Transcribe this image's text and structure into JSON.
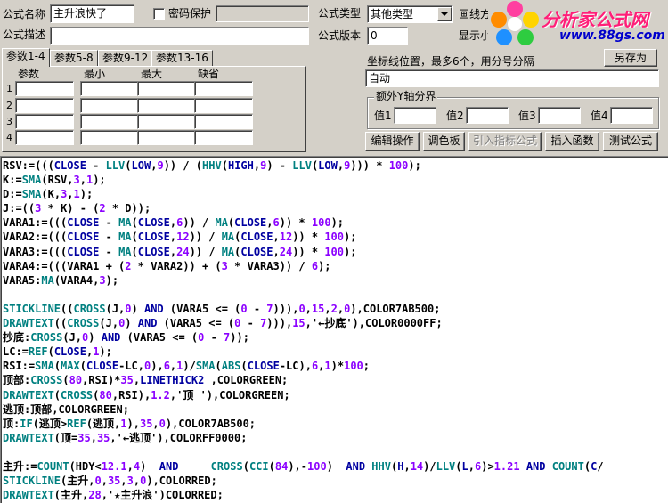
{
  "formula": {
    "name_label": "公式名称",
    "name_value": "主升浪快了",
    "password_label": "密码保护",
    "desc_label": "公式描述",
    "desc_value": "",
    "type_label": "公式类型",
    "type_value": "其他类型",
    "draw_label": "画线方",
    "version_label": "公式版本",
    "version_value": "0",
    "show_label": "显示小"
  },
  "tabs": [
    "参数1-4",
    "参数5-8",
    "参数9-12",
    "参数13-16"
  ],
  "params": {
    "headers": [
      "参数",
      "最小",
      "最大",
      "缺省"
    ],
    "rows": [
      "1",
      "2",
      "3",
      "4"
    ]
  },
  "coord": {
    "label": "坐标线位置，最多6个，用分号分隔",
    "value": "自动",
    "save_as": "另存为"
  },
  "yaxis": {
    "title": "额外Y轴分界",
    "labels": [
      "值1",
      "值2",
      "值3",
      "值4"
    ]
  },
  "buttons": [
    "编辑操作",
    "调色板",
    "引入指标公式",
    "插入函数",
    "测试公式"
  ],
  "logo": {
    "title": "分析家公式网",
    "url": "www.88gs.com"
  },
  "code_lines": [
    "RSV:=(((CLOSE - LLV(LOW,9)) / (HHV(HIGH,9) - LLV(LOW,9))) * 100);",
    "K:=SMA(RSV,3,1);",
    "D:=SMA(K,3,1);",
    "J:=((3 * K) - (2 * D));",
    "VARA1:=(((CLOSE - MA(CLOSE,6)) / MA(CLOSE,6)) * 100);",
    "VARA2:=(((CLOSE - MA(CLOSE,12)) / MA(CLOSE,12)) * 100);",
    "VARA3:=(((CLOSE - MA(CLOSE,24)) / MA(CLOSE,24)) * 100);",
    "VARA4:=(((VARA1 + (2 * VARA2)) + (3 * VARA3)) / 6);",
    "VARA5:MA(VARA4,3);",
    "",
    "STICKLINE((CROSS(J,0) AND (VARA5 <= (0 - 7))),0,15,2,0),COLOR7AB500;",
    "DRAWTEXT((CROSS(J,0) AND (VARA5 <= (0 - 7))),15,'←抄底'),COLOR0000FF;",
    "抄底:CROSS(J,0) AND (VARA5 <= (0 - 7));",
    "LC:=REF(CLOSE,1);",
    "RSI:=SMA(MAX(CLOSE-LC,0),6,1)/SMA(ABS(CLOSE-LC),6,1)*100;",
    "顶部:CROSS(80,RSI)*35,LINETHICK2 ,COLORGREEN;",
    "DRAWTEXT(CROSS(80,RSI),1.2,'顶 '),COLORGREEN;",
    "逃顶:顶部,COLORGREEN;",
    "顶:IF(逃顶>REF(逃顶,1),35,0),COLOR7AB500;",
    "DRAWTEXT(顶=35,35,'←逃顶'),COLORFF0000;",
    "",
    "主升:=COUNT(HDY<12.1,4)  AND     CROSS(CCI(84),-100)  AND HHV(H,14)/LLV(L,6)>1.21 AND COUNT(C/",
    "STICKLINE(主升,0,35,3,0),COLORRED;",
    "DRAWTEXT(主升,28,'★主升浪')COLORRED;"
  ]
}
